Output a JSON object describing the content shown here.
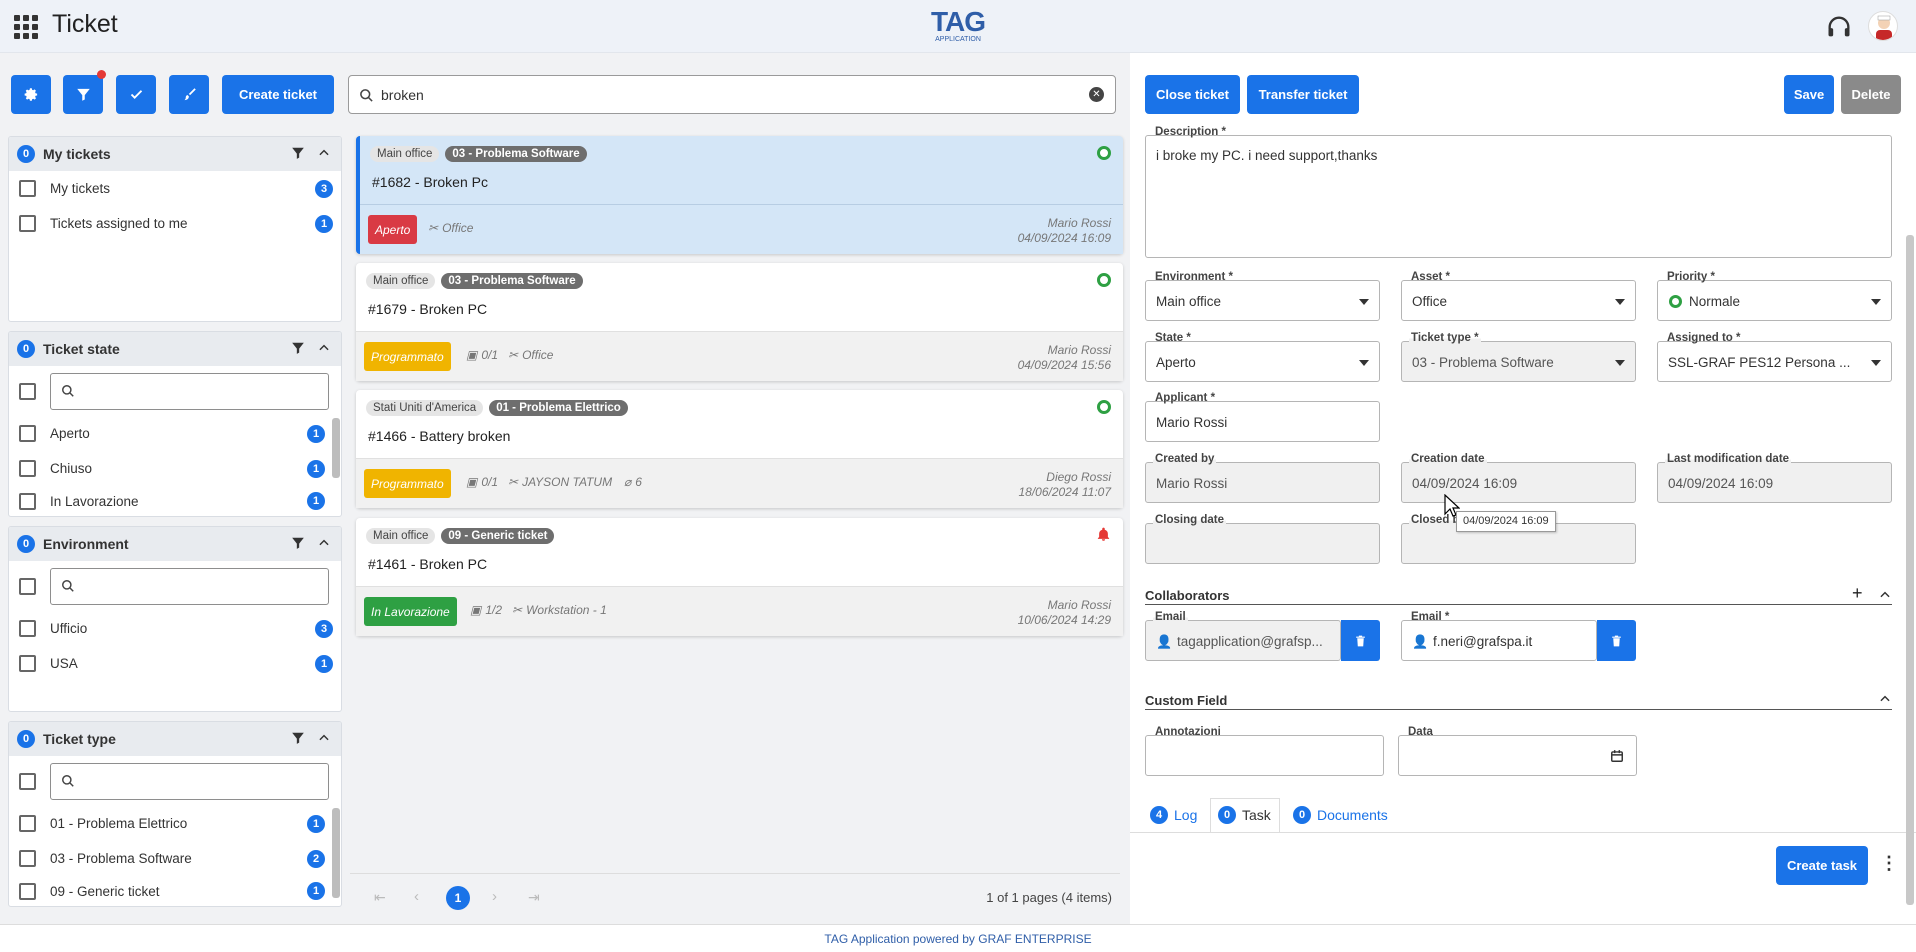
{
  "header": {
    "title": "Ticket",
    "logo_main": "TAG",
    "logo_sub": "APPLICATION"
  },
  "toolbar": {
    "create_ticket": "Create ticket",
    "search_value": "broken"
  },
  "sidebar": {
    "my_tickets": {
      "title": "My tickets",
      "count": "0",
      "items": [
        {
          "label": "My tickets",
          "count": "3"
        },
        {
          "label": "Tickets assigned to me",
          "count": "1"
        }
      ]
    },
    "ticket_state": {
      "title": "Ticket state",
      "count": "0",
      "items": [
        {
          "label": "Aperto",
          "count": "1"
        },
        {
          "label": "Chiuso",
          "count": "1"
        },
        {
          "label": "In Lavorazione",
          "count": "1"
        }
      ]
    },
    "environment": {
      "title": "Environment",
      "count": "0",
      "items": [
        {
          "label": "Ufficio",
          "count": "3"
        },
        {
          "label": "USA",
          "count": "1"
        }
      ]
    },
    "ticket_type": {
      "title": "Ticket type",
      "count": "0",
      "items": [
        {
          "label": "01 - Problema Elettrico",
          "count": "1"
        },
        {
          "label": "03 - Problema Software",
          "count": "2"
        },
        {
          "label": "09 - Generic ticket",
          "count": "1"
        }
      ]
    }
  },
  "tickets": [
    {
      "env": "Main office",
      "type": "03 - Problema Software",
      "title": "#1682 - Broken Pc",
      "state": "Aperto",
      "tasks": "",
      "asset": "Office",
      "attachments": "",
      "user": "Mario Rossi",
      "date": "04/09/2024 16:09"
    },
    {
      "env": "Main office",
      "type": "03 - Problema Software",
      "title": "#1679 - Broken PC",
      "state": "Programmato",
      "tasks": "0/1",
      "asset": "Office",
      "attachments": "",
      "user": "Mario Rossi",
      "date": "04/09/2024 15:56"
    },
    {
      "env": "Stati Uniti d'America",
      "type": "01 - Problema Elettrico",
      "title": "#1466 - Battery broken",
      "state": "Programmato",
      "tasks": "0/1",
      "asset": "JAYSON TATUM",
      "attachments": "6",
      "user": "Diego Rossi",
      "date": "18/06/2024 11:07"
    },
    {
      "env": "Main office",
      "type": "09 - Generic ticket",
      "title": "#1461 - Broken PC",
      "state": "In Lavorazione",
      "tasks": "1/2",
      "asset": "Workstation - 1",
      "attachments": "",
      "user": "Mario Rossi",
      "date": "10/06/2024 14:29"
    }
  ],
  "pagination": {
    "current": "1",
    "summary": "1 of 1 pages (4 items)"
  },
  "detail": {
    "close_ticket": "Close ticket",
    "transfer_ticket": "Transfer ticket",
    "save": "Save",
    "delete": "Delete",
    "description_label": "Description *",
    "description_value": "i broke my PC. i need support,thanks",
    "environment_label": "Environment *",
    "environment_value": "Main office",
    "asset_label": "Asset *",
    "asset_value": "Office",
    "priority_label": "Priority *",
    "priority_value": "Normale",
    "state_label": "State *",
    "state_value": "Aperto",
    "ticket_type_label": "Ticket type *",
    "ticket_type_value": "03 - Problema Software",
    "assigned_label": "Assigned to *",
    "assigned_value": "SSL-GRAF PES12 Persona ...",
    "applicant_label": "Applicant *",
    "applicant_value": "Mario Rossi",
    "created_by_label": "Created by",
    "created_by_value": "Mario Rossi",
    "creation_date_label": "Creation date",
    "creation_date_value": "04/09/2024 16:09",
    "last_mod_label": "Last modification date",
    "last_mod_value": "04/09/2024 16:09",
    "closing_date_label": "Closing date",
    "closed_by_label": "Closed b",
    "tooltip": "04/09/2024 16:09",
    "collaborators_title": "Collaborators",
    "email1_label": "Email",
    "email1_value": "tagapplication@grafsp...",
    "email2_label": "Email *",
    "email2_value": "f.neri@grafspa.it",
    "custom_field_title": "Custom Field",
    "annotazioni_label": "Annotazioni",
    "data_label": "Data",
    "tabs": [
      {
        "count": "4",
        "label": "Log"
      },
      {
        "count": "0",
        "label": "Task"
      },
      {
        "count": "0",
        "label": "Documents"
      }
    ],
    "create_task": "Create task"
  },
  "footer": "TAG Application powered by GRAF ENTERPRISE",
  "colors": {
    "primary": "#1a73e8",
    "aperto": "#d93a44",
    "programmato": "#f0b400",
    "in_lavorazione": "#2ea043"
  }
}
